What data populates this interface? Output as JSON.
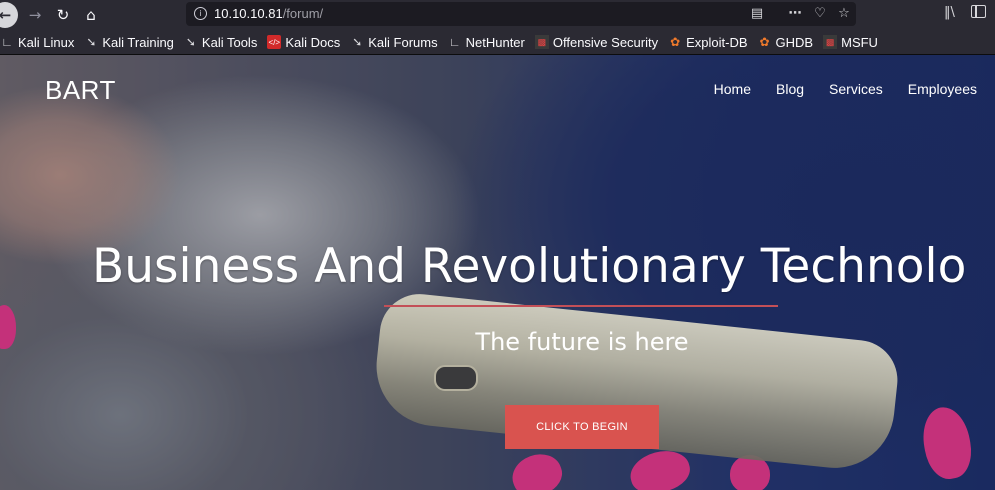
{
  "browser": {
    "url_host": "10.10.10.81",
    "url_path": "/forum/",
    "bookmarks": [
      {
        "label": "Kali Linux",
        "icon": "kali-dragon-icon"
      },
      {
        "label": "Kali Training",
        "icon": "kali-dragon-icon"
      },
      {
        "label": "Kali Tools",
        "icon": "kali-dragon-icon"
      },
      {
        "label": "Kali Docs",
        "icon": "kali-docs-icon"
      },
      {
        "label": "Kali Forums",
        "icon": "kali-dragon-icon"
      },
      {
        "label": "NetHunter",
        "icon": "nethunter-icon"
      },
      {
        "label": "Offensive Security",
        "icon": "offsec-icon"
      },
      {
        "label": "Exploit-DB",
        "icon": "exploit-db-icon"
      },
      {
        "label": "GHDB",
        "icon": "exploit-db-icon"
      },
      {
        "label": "MSFU",
        "icon": "offsec-icon"
      }
    ]
  },
  "site": {
    "brand": "BART",
    "nav": [
      "Home",
      "Blog",
      "Services",
      "Employees"
    ],
    "headline": "Business And Revolutionary Technolo",
    "tagline": "The future is here",
    "cta": "CLICK TO BEGIN"
  },
  "colors": {
    "cta": "#d9534f",
    "divider": "#c34f57",
    "toolbar": "#2b2a33"
  }
}
